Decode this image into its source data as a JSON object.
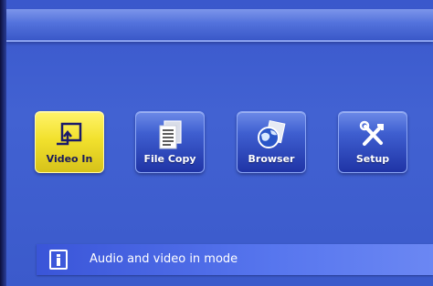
{
  "menu": {
    "items": [
      {
        "label": "Video In",
        "icon": "video-in-icon",
        "selected": true
      },
      {
        "label": "File Copy",
        "icon": "file-copy-icon",
        "selected": false
      },
      {
        "label": "Browser",
        "icon": "browser-globe-icon",
        "selected": false
      },
      {
        "label": "Setup",
        "icon": "setup-tools-icon",
        "selected": false
      }
    ]
  },
  "status": {
    "icon": "info-icon",
    "text": "Audio and video in mode"
  },
  "colors": {
    "background": "#3f5fd0",
    "header": "#5372dc",
    "selected": "#f2e12d",
    "status_bar": "#5776ee"
  }
}
